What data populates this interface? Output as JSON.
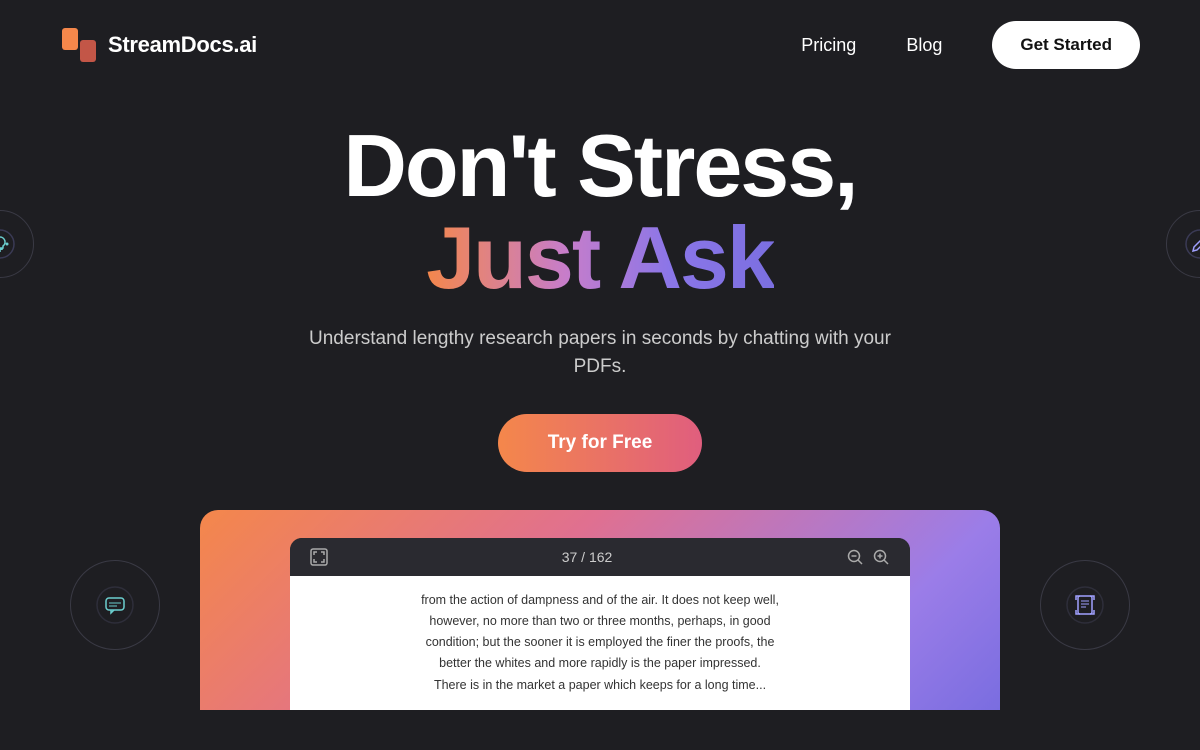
{
  "nav": {
    "logo_text": "StreamDocs.ai",
    "links": [
      {
        "label": "Pricing",
        "id": "pricing"
      },
      {
        "label": "Blog",
        "id": "blog"
      }
    ],
    "cta_label": "Get Started"
  },
  "hero": {
    "title_line1": "Don't Stress,",
    "title_line2": "Just Ask",
    "description": "Understand lengthy research papers in seconds by chatting with your PDFs.",
    "cta_label": "Try for Free"
  },
  "pdf_preview": {
    "page_current": "37",
    "page_separator": "/",
    "page_total": "162",
    "content_line1": "from the action of dampness and of the air. It does not keep well,",
    "content_line2": "however, no more than two or three months, perhaps, in good",
    "content_line3": "condition; but the sooner it is employed the finer the proofs, the",
    "content_line4": "better the whites and more rapidly is the paper impressed.",
    "content_line5": "There is in the market a paper which keeps for a long time..."
  },
  "colors": {
    "brand_orange": "#f4874b",
    "brand_purple": "#8b76e8",
    "bg_dark": "#1e1e22",
    "nav_bg": "#1e1e22",
    "cta_bg": "#ffffff",
    "try_btn_start": "#f4874b",
    "try_btn_end": "#e05e7e"
  }
}
